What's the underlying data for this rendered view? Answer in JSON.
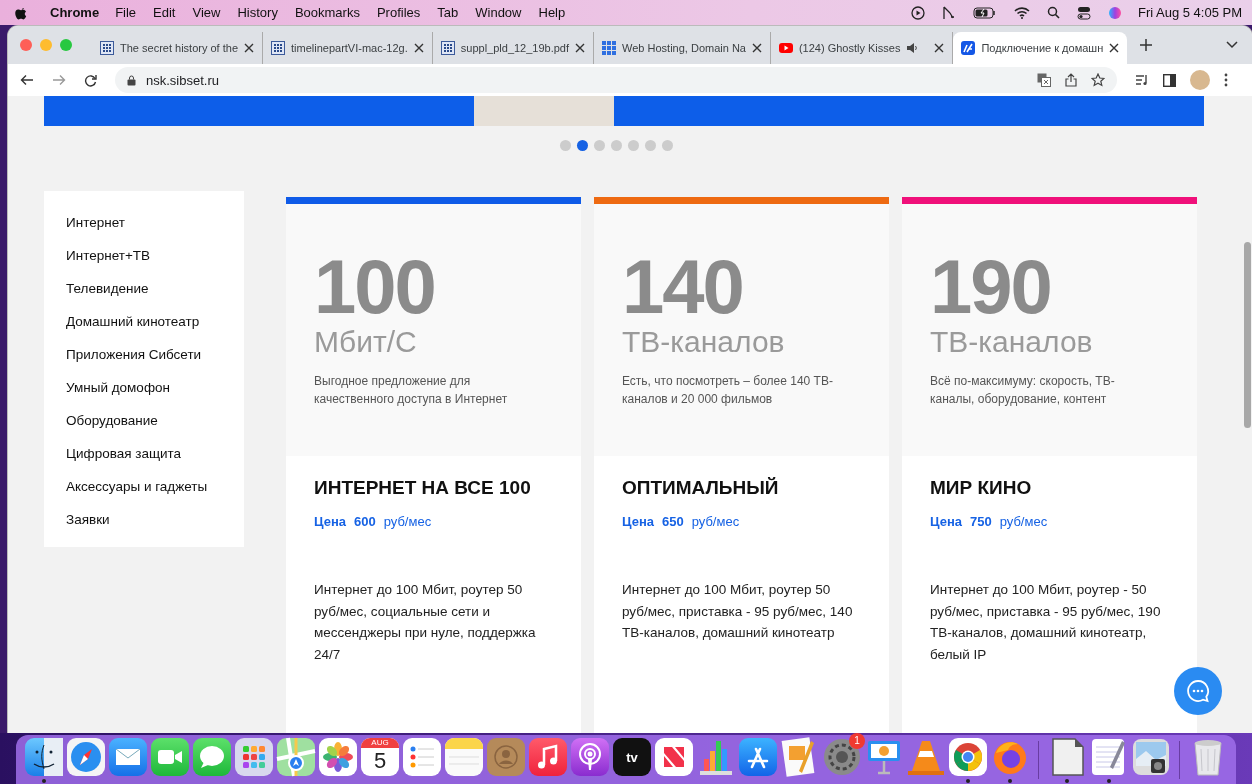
{
  "menu_bar": {
    "app": "Chrome",
    "items": [
      "File",
      "Edit",
      "View",
      "History",
      "Bookmarks",
      "Profiles",
      "Tab",
      "Window",
      "Help"
    ],
    "clock": "Fri Aug 5  4:05 PM"
  },
  "tabs": [
    {
      "title": "The secret history of the",
      "kind": "sheet",
      "selected": false,
      "audio": false
    },
    {
      "title": "timelinepartVI-mac-12g.",
      "kind": "sheet",
      "selected": false,
      "audio": false
    },
    {
      "title": "suppl_pld_12_19b.pdf",
      "kind": "sheet",
      "selected": false,
      "audio": false
    },
    {
      "title": "Web Hosting, Domain Na",
      "kind": "dots",
      "selected": false,
      "audio": false
    },
    {
      "title": "(124) Ghostly Kisses",
      "kind": "video",
      "selected": false,
      "audio": true
    },
    {
      "title": "Подключение к домашн",
      "kind": "site",
      "selected": true,
      "audio": false
    }
  ],
  "address": "nsk.sibset.ru",
  "carousel": {
    "dots": [
      {
        "selected": false
      },
      {
        "selected": true
      },
      {
        "selected": false
      },
      {
        "selected": false
      },
      {
        "selected": false
      },
      {
        "selected": false
      },
      {
        "selected": false
      }
    ]
  },
  "sidebar": {
    "items": [
      "Интернет",
      "Интернет+ТВ",
      "Телевидение",
      "Домашний кинотеатр",
      "Приложения Сибсети",
      "Умный домофон",
      "Оборудование",
      "Цифровая защита",
      "Аксессуары и гаджеты",
      "Заявки"
    ]
  },
  "plans": [
    {
      "color": "#0f5be8",
      "number": "100",
      "unit": "Мбит/С",
      "description": "Выгодное предложение для качественного доступа в Интернет",
      "name": "ИНТЕРНЕТ НА ВСЕ 100",
      "price_label": "Цена",
      "price": "600",
      "price_unit": "руб/мес",
      "details": "Интернет до 100 Мбит, роутер 50 руб/мес, социальные сети и мессенджеры при нуле, поддержка 24/7"
    },
    {
      "color": "#ee6a12",
      "number": "140",
      "unit": "ТВ-каналов",
      "description": "Есть, что посмотреть – более 140 ТВ-каналов и 20 000 фильмов",
      "name": "ОПТИМАЛЬНЫЙ",
      "price_label": "Цена",
      "price": "650",
      "price_unit": "руб/мес",
      "details": "Интернет до 100 Мбит, роутер 50 руб/мес, приставка - 95 руб/мес, 140 ТВ-каналов, домашний кинотеатр"
    },
    {
      "color": "#f0107a",
      "number": "190",
      "unit": "ТВ-каналов",
      "description": "Всё по-максимуму: скорость, ТВ-каналы, оборудование, контент",
      "name": "МИР КИНО",
      "price_label": "Цена",
      "price": "750",
      "price_unit": "руб/мес",
      "details": "Интернет до 100 Мбит, роутер - 50 руб/мес, приставка - 95 руб/мес, 190 ТВ-каналов, домашний кинотеатр, белый IP"
    }
  ],
  "dock": [
    {
      "kind": "face",
      "running": true
    },
    {
      "kind": "compass",
      "running": false
    },
    {
      "kind": "envelope",
      "running": false
    },
    {
      "kind": "camera",
      "running": false
    },
    {
      "kind": "bubble",
      "running": false
    },
    {
      "kind": "grid",
      "running": false
    },
    {
      "kind": "map",
      "running": false
    },
    {
      "kind": "flower",
      "running": false
    },
    {
      "kind": "calendar",
      "running": false,
      "month": "AUG",
      "day": "5"
    },
    {
      "kind": "list",
      "running": false
    },
    {
      "kind": "notepad",
      "running": false
    },
    {
      "kind": "person",
      "running": false
    },
    {
      "kind": "note",
      "running": false
    },
    {
      "kind": "podcast",
      "running": false
    },
    {
      "kind": "tv",
      "running": false,
      "label": "tv"
    },
    {
      "kind": "news",
      "running": false
    },
    {
      "kind": "chart",
      "running": false
    },
    {
      "kind": "appstore",
      "running": false
    },
    {
      "kind": "pen",
      "running": false
    },
    {
      "kind": "gear",
      "running": false,
      "badge": "1"
    },
    {
      "kind": "podium",
      "running": false
    },
    {
      "kind": "cone",
      "running": false
    },
    {
      "kind": "chrome",
      "running": true
    },
    {
      "kind": "fox",
      "running": true
    },
    {
      "kind": "divider"
    },
    {
      "kind": "document",
      "running": true
    },
    {
      "kind": "textedit",
      "running": true
    },
    {
      "kind": "preview",
      "running": false
    },
    {
      "kind": "divider"
    },
    {
      "kind": "trash",
      "running": false
    }
  ]
}
